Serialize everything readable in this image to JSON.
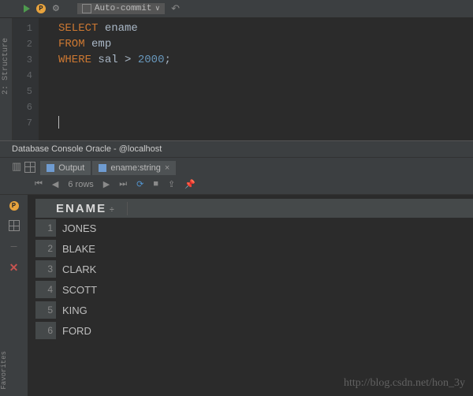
{
  "toolbar": {
    "auto_commit": "Auto-commit"
  },
  "sidebar": {
    "structure": "2: Structure"
  },
  "editor": {
    "lines": [
      "1",
      "2",
      "3",
      "4",
      "5",
      "6",
      "7"
    ],
    "sql": {
      "select": "SELECT",
      "ename": "ename",
      "from": "FROM",
      "emp": "emp",
      "where": "WHERE",
      "sal": "sal",
      "gt": ">",
      "val": "2000",
      "semi": ";"
    }
  },
  "console_title": "Database Console Oracle - @localhost",
  "tabs": {
    "output": "Output",
    "col": "ename:string"
  },
  "result_toolbar": {
    "rows": "6 rows"
  },
  "result": {
    "header": "ENAME",
    "rows": [
      {
        "n": "1",
        "v": "JONES"
      },
      {
        "n": "2",
        "v": "BLAKE"
      },
      {
        "n": "3",
        "v": "CLARK"
      },
      {
        "n": "4",
        "v": "SCOTT"
      },
      {
        "n": "5",
        "v": "KING"
      },
      {
        "n": "6",
        "v": "FORD"
      }
    ]
  },
  "favorites_label": "Favorites",
  "watermark": "http://blog.csdn.net/hon_3y"
}
